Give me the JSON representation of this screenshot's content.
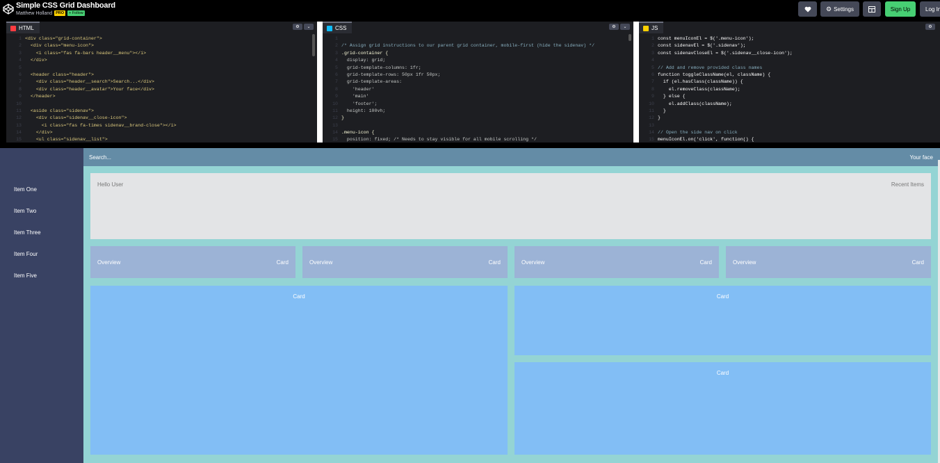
{
  "topbar": {
    "title": "Simple CSS Grid Dashboard",
    "author": "Matthew Holland",
    "pro_badge": "PRO",
    "follow_badge": "+ Follow",
    "settings_label": "Settings",
    "signup_label": "Sign Up",
    "login_label": "Log In",
    "heart_icon": "heart-icon",
    "gear_icon": "gear-icon",
    "layout_icon": "layout-icon"
  },
  "editors": {
    "html": {
      "label": "HTML",
      "accent": "#ff3c41",
      "lines": [
        {
          "n": "1",
          "t": "<div class=\"grid-container\">"
        },
        {
          "n": "2",
          "t": "  <div class=\"menu-icon\">"
        },
        {
          "n": "3",
          "t": "    <i class=\"fas fa-bars header__menu\"></i>"
        },
        {
          "n": "4",
          "t": "  </div>"
        },
        {
          "n": "5",
          "t": ""
        },
        {
          "n": "6",
          "t": "  <header class=\"header\">"
        },
        {
          "n": "7",
          "t": "    <div class=\"header__search\">Search...</div>"
        },
        {
          "n": "8",
          "t": "    <div class=\"header__avatar\">Your face</div>"
        },
        {
          "n": "9",
          "t": "  </header>"
        },
        {
          "n": "10",
          "t": ""
        },
        {
          "n": "11",
          "t": "  <aside class=\"sidenav\">"
        },
        {
          "n": "12",
          "t": "    <div class=\"sidenav__close-icon\">"
        },
        {
          "n": "13",
          "t": "      <i class=\"fas fa-times sidenav__brand-close\"></i>"
        },
        {
          "n": "14",
          "t": "    </div>"
        },
        {
          "n": "15",
          "t": "    <ul class=\"sidenav__list\">"
        }
      ]
    },
    "css": {
      "label": "CSS",
      "accent": "#0ebeff",
      "lines": [
        {
          "n": "1",
          "t": ""
        },
        {
          "n": "2",
          "t": "/* Assign grid instructions to our parent grid container, mobile-first (hide the sidenav) */"
        },
        {
          "n": "3",
          "t": ".grid-container {"
        },
        {
          "n": "4",
          "t": "  display: grid;"
        },
        {
          "n": "5",
          "t": "  grid-template-columns: 1fr;"
        },
        {
          "n": "6",
          "t": "  grid-template-rows: 50px 1fr 50px;"
        },
        {
          "n": "7",
          "t": "  grid-template-areas:"
        },
        {
          "n": "8",
          "t": "    'header'"
        },
        {
          "n": "9",
          "t": "    'main'"
        },
        {
          "n": "10",
          "t": "    'footer';"
        },
        {
          "n": "11",
          "t": "  height: 100vh;"
        },
        {
          "n": "12",
          "t": "}"
        },
        {
          "n": "13",
          "t": ""
        },
        {
          "n": "14",
          "t": ".menu-icon {"
        },
        {
          "n": "15",
          "t": "  position: fixed; /* Needs to stay visible for all mobile scrolling */"
        }
      ]
    },
    "js": {
      "label": "JS",
      "accent": "#fcd000",
      "lines": [
        {
          "n": "1",
          "t": "const menuIconEl = $('.menu-icon');"
        },
        {
          "n": "2",
          "t": "const sidenavEl = $('.sidenav');"
        },
        {
          "n": "3",
          "t": "const sidenavCloseEl = $('.sidenav__close-icon');"
        },
        {
          "n": "4",
          "t": ""
        },
        {
          "n": "5",
          "t": "// Add and remove provided class names"
        },
        {
          "n": "6",
          "t": "function toggleClassName(el, className) {"
        },
        {
          "n": "7",
          "t": "  if (el.hasClass(className)) {"
        },
        {
          "n": "8",
          "t": "    el.removeClass(className);"
        },
        {
          "n": "9",
          "t": "  } else {"
        },
        {
          "n": "10",
          "t": "    el.addClass(className);"
        },
        {
          "n": "11",
          "t": "  }"
        },
        {
          "n": "12",
          "t": "}"
        },
        {
          "n": "13",
          "t": ""
        },
        {
          "n": "14",
          "t": "// Open the side nav on click"
        },
        {
          "n": "15",
          "t": "menuIconEl.on('click', function() {"
        }
      ]
    }
  },
  "preview": {
    "header": {
      "search": "Search...",
      "avatar": "Your face"
    },
    "sidenav": {
      "items": [
        "Item One",
        "Item Two",
        "Item Three",
        "Item Four",
        "Item Five"
      ]
    },
    "overview": {
      "left": "Hello User",
      "right": "Recent Items"
    },
    "overview_cards": [
      {
        "left": "Overview",
        "right": "Card"
      },
      {
        "left": "Overview",
        "right": "Card"
      },
      {
        "left": "Overview",
        "right": "Card"
      },
      {
        "left": "Overview",
        "right": "Card"
      }
    ],
    "main_cards": [
      "Card",
      "Card",
      "Card"
    ]
  }
}
